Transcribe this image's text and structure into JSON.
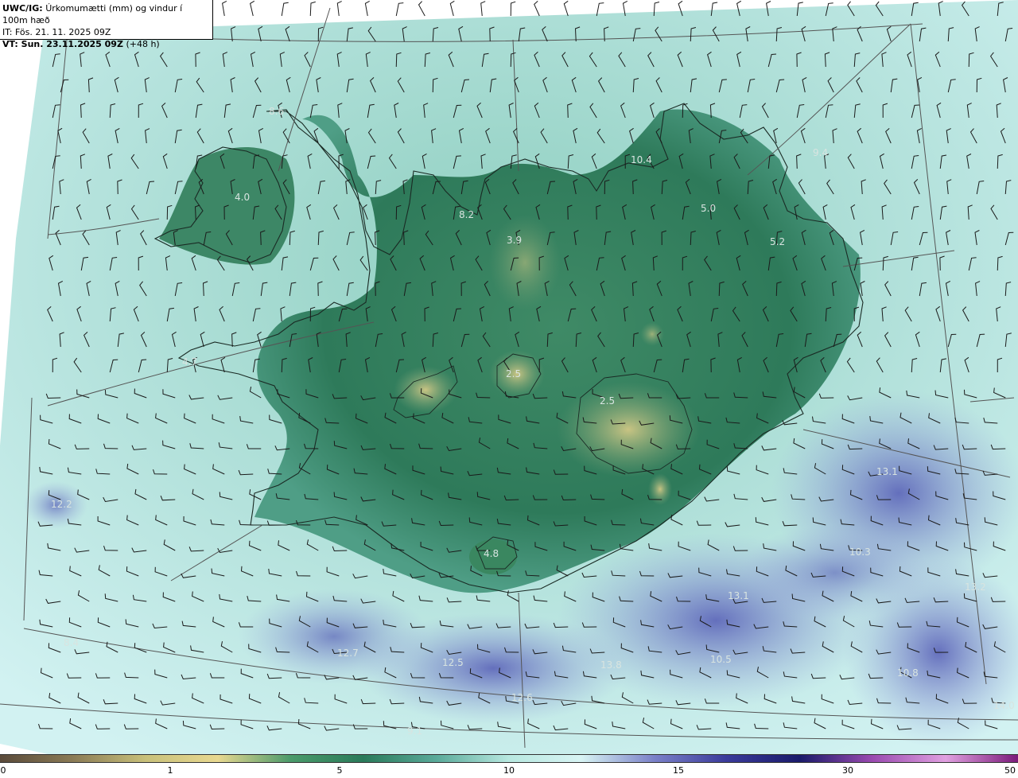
{
  "header": {
    "line1_bold": "UWC/IG:",
    "line1_rest": "Úrkomumætti (mm) og vindur í 100m hæð",
    "line2": "IT: Fös. 21. 11. 2025 09Z",
    "line3_bold": "VT: Sun. 23.11.2025 09Z",
    "line3_rest": "(+48 h)"
  },
  "value_labels": [
    "8.6",
    "4.0",
    "8.2",
    "3.9",
    "5.0",
    "9.4",
    "5.2",
    "4.7",
    "2.5",
    "2.5",
    "12.2",
    "4.8",
    "13.1",
    "13.1",
    "13.2",
    "12.7",
    "12.5",
    "13.8",
    "10.5",
    "12.6",
    "10.8",
    "14.0",
    "9.1",
    "10.3",
    "8.4",
    "10.4"
  ],
  "colorbar": {
    "ticks": [
      "0",
      "1",
      "5",
      "10",
      "15",
      "30",
      "50"
    ],
    "colors": [
      "#5a4a3a",
      "#8a7a55",
      "#c8c07a",
      "#e8d890",
      "#4a9a6a",
      "#2a7a5a",
      "#5aaa9a",
      "#b8e8e0",
      "#d8f4f4",
      "#7a80c8",
      "#3a3a9a",
      "#1a1a6a",
      "#9a4ab0",
      "#e0a0e0",
      "#7a1a7a"
    ]
  },
  "colors": {
    "ocean_light": "#c6ecea",
    "land_dark": "#2f7a5c",
    "precip_high": "#6f79c6",
    "dry_highland": "#b8b978"
  }
}
